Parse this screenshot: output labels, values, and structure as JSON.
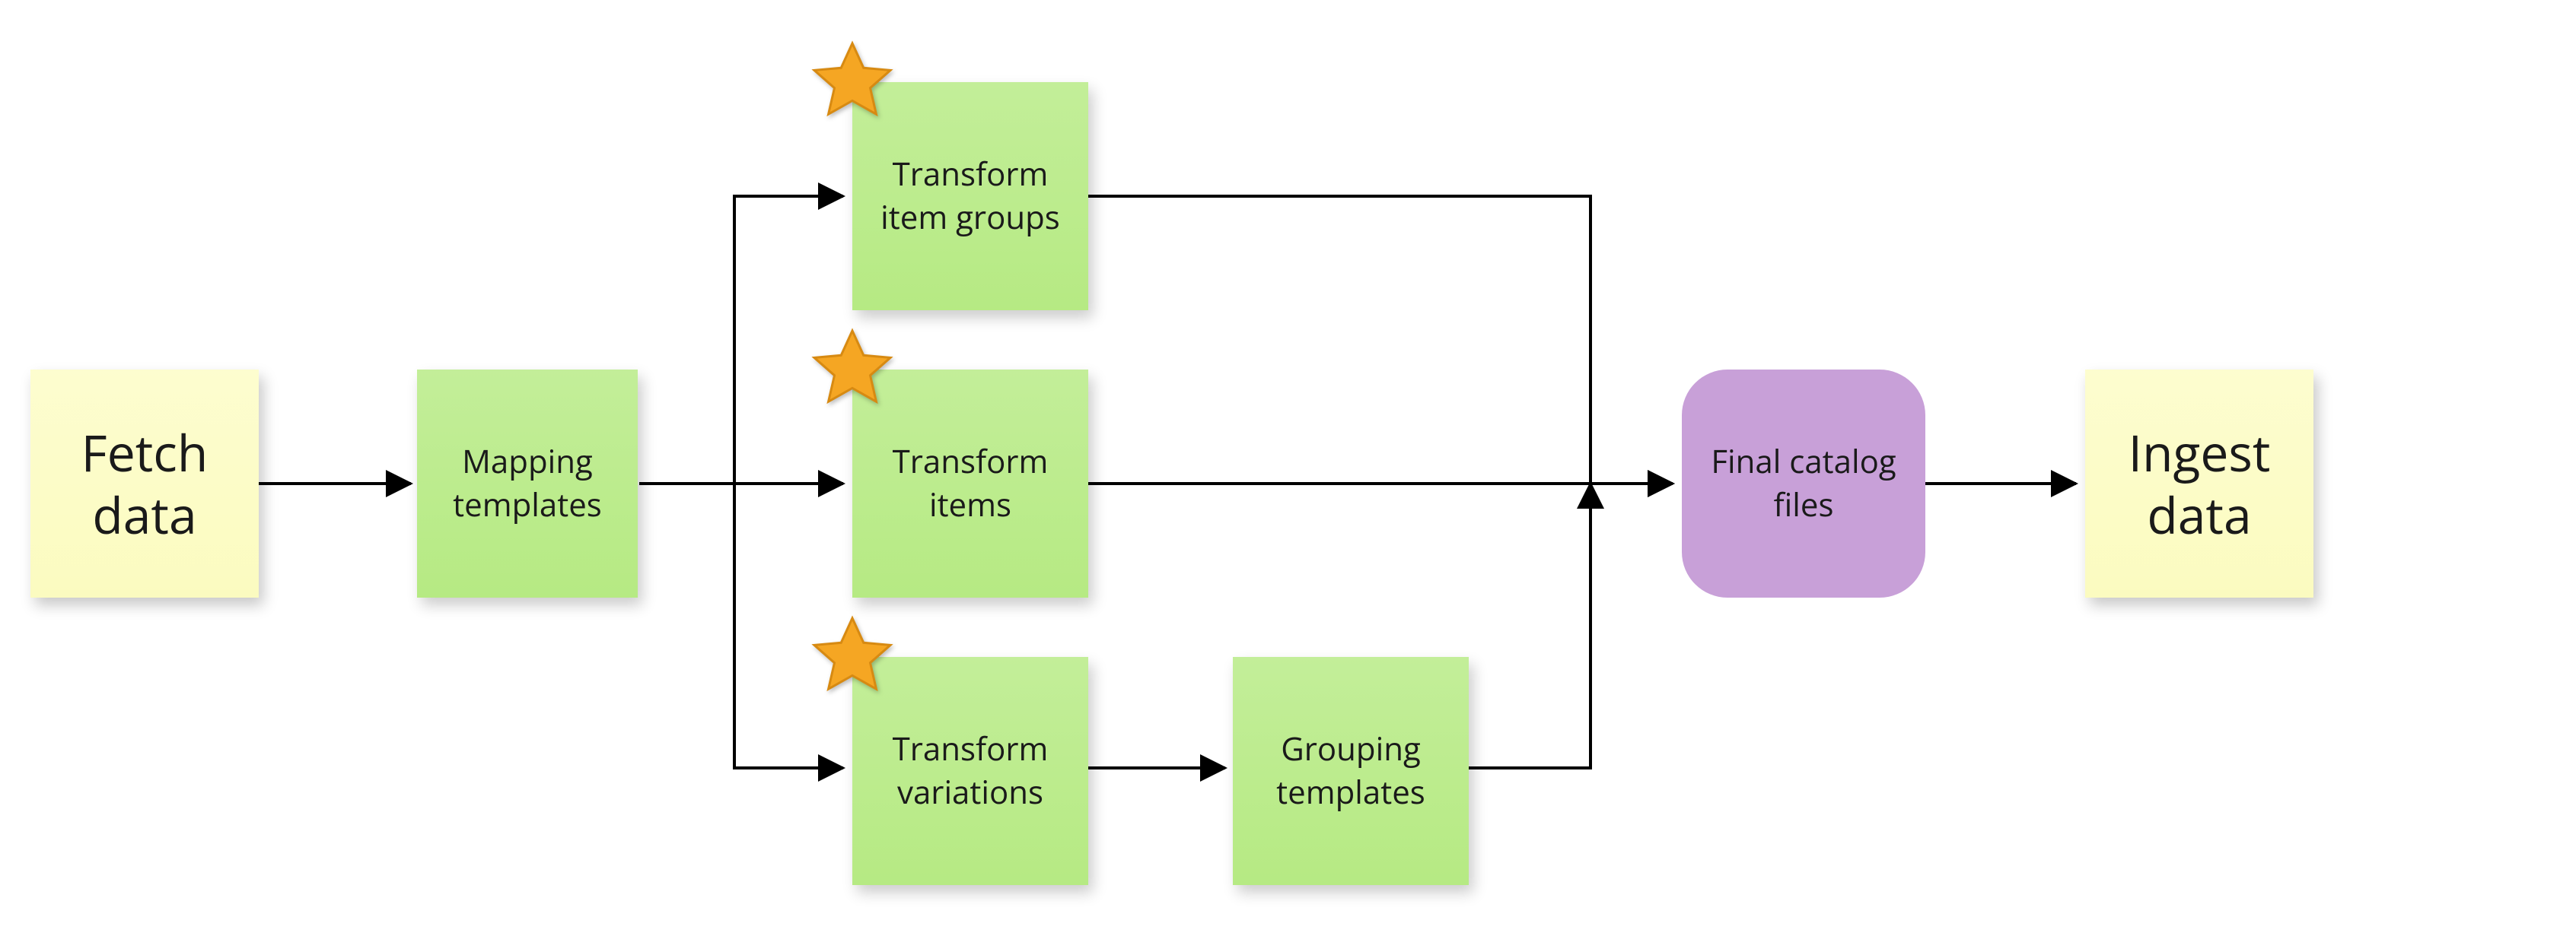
{
  "colors": {
    "yellow": "#fbfbc0",
    "green": "#b6ea83",
    "purple": "#c8a0d8",
    "star_fill": "#f5a623",
    "star_stroke": "#d78a12",
    "arrow": "#000000"
  },
  "nodes": {
    "fetch_data": {
      "label": "Fetch data",
      "type": "yellow",
      "starred": false
    },
    "mapping_templates": {
      "label": "Mapping templates",
      "type": "green",
      "starred": false
    },
    "transform_item_groups": {
      "label": "Transform item groups",
      "type": "green",
      "starred": true
    },
    "transform_items": {
      "label": "Transform items",
      "type": "green",
      "starred": true
    },
    "transform_variations": {
      "label": "Transform variations",
      "type": "green",
      "starred": true
    },
    "grouping_templates": {
      "label": "Grouping templates",
      "type": "green",
      "starred": false
    },
    "final_catalog_files": {
      "label": "Final catalog files",
      "type": "purple",
      "starred": false
    },
    "ingest_data": {
      "label": "Ingest data",
      "type": "yellow",
      "starred": false
    }
  },
  "edges": [
    {
      "from": "fetch_data",
      "to": "mapping_templates"
    },
    {
      "from": "mapping_templates",
      "to": "transform_item_groups"
    },
    {
      "from": "mapping_templates",
      "to": "transform_items"
    },
    {
      "from": "mapping_templates",
      "to": "transform_variations"
    },
    {
      "from": "transform_item_groups",
      "to": "final_catalog_files"
    },
    {
      "from": "transform_items",
      "to": "final_catalog_files"
    },
    {
      "from": "transform_variations",
      "to": "grouping_templates"
    },
    {
      "from": "grouping_templates",
      "to": "final_catalog_files"
    },
    {
      "from": "final_catalog_files",
      "to": "ingest_data"
    }
  ]
}
